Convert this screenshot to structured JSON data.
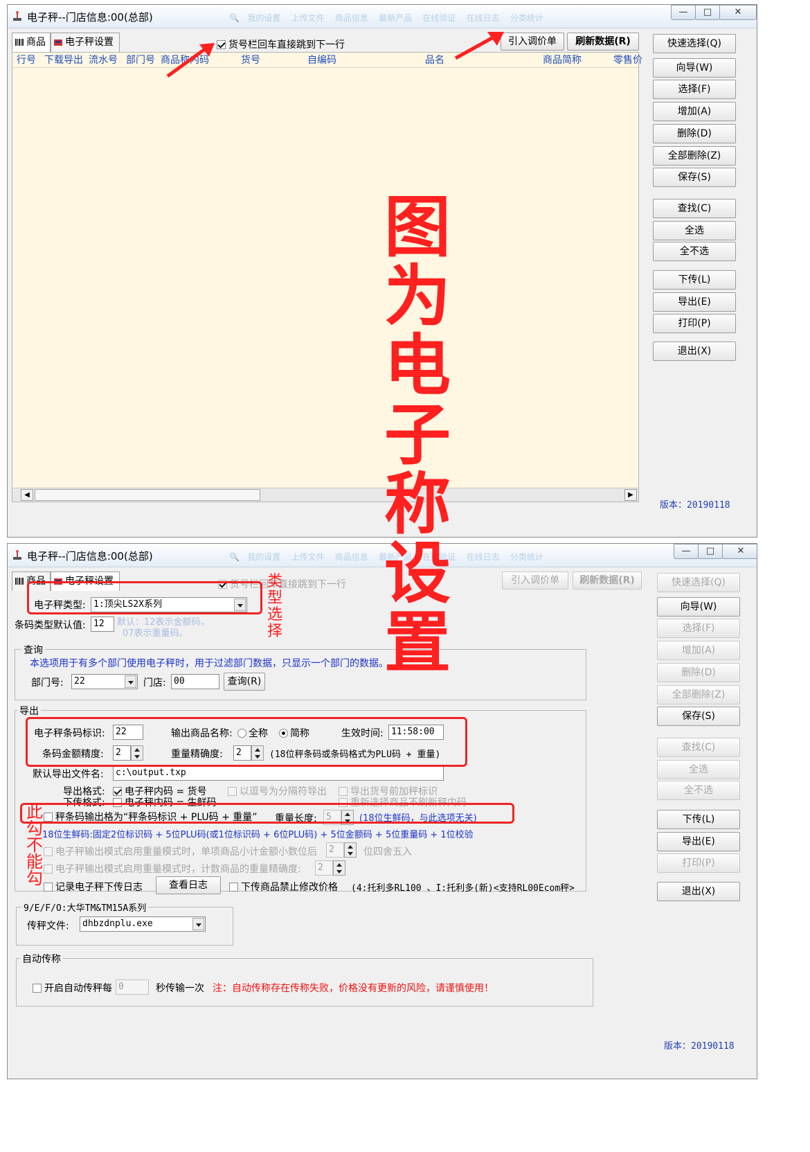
{
  "window1": {
    "title": "电子秤--门店信息:00(总部)",
    "window_controls": {
      "minimize": "—",
      "maximize": "□",
      "close": "✕"
    },
    "tabs": [
      {
        "label": "商品"
      },
      {
        "label": "电子秤设置"
      }
    ],
    "option_checkbox": {
      "label": "货号栏回车直接跳到下一行",
      "checked": true
    },
    "import_button": "引入调价单",
    "refresh_button": "刷新数据(R)",
    "columns": [
      "行号",
      "下载导出",
      "流水号",
      "部门号",
      "商品称内码",
      "货号",
      "自编码",
      "品名",
      "商品简称",
      "零售价"
    ],
    "side_buttons": [
      "快速选择(Q)",
      "向导(W)",
      "选择(F)",
      "增加(A)",
      "删除(D)",
      "全部删除(Z)",
      "保存(S)",
      "查找(C)",
      "全选",
      "全不选",
      "下传(L)",
      "导出(E)",
      "打印(P)",
      "退出(X)"
    ],
    "version": "版本：20190118"
  },
  "window2": {
    "title": "电子秤--门店信息:00(总部)",
    "window_controls": {
      "minimize": "—",
      "maximize": "□",
      "close": "✕"
    },
    "tabs": [
      {
        "label": "商品"
      },
      {
        "label": "电子秤设置"
      }
    ],
    "option_checkbox": {
      "label": "货号栏回车直接跳到下一行"
    },
    "import_button": "引入调价单",
    "refresh_button": "刷新数据(R)",
    "scale_type": {
      "label": "电子秤类型:",
      "value": "1:顶尖LS2X系列"
    },
    "barcode_default": {
      "label": "条码类型默认值:",
      "value": "12",
      "hint_line1": "默认：12表示金额码，",
      "hint_line2": "07表示重量码。"
    },
    "query_group": {
      "title": "查询",
      "desc": "本选项用于有多个部门使用电子秤时，用于过滤部门数据，只显示一个部门的数据。",
      "dept_label": "部门号:",
      "dept_value": "22",
      "store_label": "门店:",
      "store_value": "00",
      "query_button": "查询(R)"
    },
    "export_group": {
      "title": "导出",
      "barcode_flag_label": "电子秤条码标识:",
      "barcode_flag_value": "22",
      "name_output_label": "输出商品名称:",
      "name_full": "全称",
      "name_short": "简称",
      "effective_time_label": "生效时间:",
      "effective_time_value": "11:58:00",
      "amount_precision_label": "条码金额精度:",
      "amount_precision_value": "2",
      "weight_precision_label": "重量精确度:",
      "weight_precision_value": "2",
      "weight_precision_note": "(18位秤条码或条码格式为PLU码 + 重量)",
      "export_file_label": "默认导出文件名:",
      "export_file_value": "c:\\output.txp",
      "export_format_label": "导出格式:",
      "export_format_value": "电子秤内码 = 货号",
      "comma_sep": "以逗号为分隔符导出",
      "prefix_scale_flag": "导出货号前加秤标识",
      "download_format_label": "下传格式:",
      "download_format_value": "电子秤内码 = 生鲜码",
      "reselect_note": "重新选择商品不刷新秤内码",
      "plu_format": "秤条码输出格为“秤条码标识 + PLU码 + 重量”",
      "weight_length_label": "重量长度:",
      "weight_length_value": "5",
      "weight_length_note": "(18位生鲜码，与此选项无关)",
      "fresh_code_desc": "18位生鲜码:固定2位标识码 + 5位PLU码(或1位标识码 + 6位PLU码) + 5位金额码 + 5位重量码 + 1位校验",
      "subtotal_decimal": "电子秤输出模式启用重量模式时，单项商品小计金额小数位后",
      "subtotal_decimal_value": "2",
      "subtotal_round": "位四舍五入",
      "count_weight_precision": "电子秤输出模式启用重量模式时，计数商品的重量精确度:",
      "count_weight_precision_value": "2",
      "log_checkbox": "记录电子秤下传日志",
      "view_log_button": "查看日志",
      "forbid_price_edit": "下传商品禁止修改价格",
      "toledo_note": "(4:托利多RL100 、I:托利多(新)<支持RL00Ecom秤>"
    },
    "dahua_group": {
      "title": "9/E/F/O:大华TM&TM15A系列",
      "file_label": "传秤文件:",
      "file_value": "dhbzdnplu.exe"
    },
    "auto_group": {
      "title": "自动传称",
      "enable_label": "开启自动传秤每",
      "interval_value": "0",
      "interval_suffix": "秒传输一次",
      "warning": "注：自动传称存在传称失败，价格没有更新的风险，请谨慎使用！"
    },
    "side_buttons": [
      {
        "label": "快速选择(Q)",
        "enabled": false
      },
      {
        "label": "向导(W)",
        "enabled": true
      },
      {
        "label": "选择(F)",
        "enabled": false
      },
      {
        "label": "增加(A)",
        "enabled": false
      },
      {
        "label": "删除(D)",
        "enabled": false
      },
      {
        "label": "全部删除(Z)",
        "enabled": false
      },
      {
        "label": "保存(S)",
        "enabled": true
      },
      {
        "label": "查找(C)",
        "enabled": false
      },
      {
        "label": "全选",
        "enabled": false
      },
      {
        "label": "全不选",
        "enabled": false
      },
      {
        "label": "下传(L)",
        "enabled": true
      },
      {
        "label": "导出(E)",
        "enabled": true
      },
      {
        "label": "打印(P)",
        "enabled": false
      },
      {
        "label": "退出(X)",
        "enabled": true
      }
    ],
    "version": "版本：20190118"
  },
  "annotations": {
    "big_caption": "图为电子称设置",
    "type_select": "类型选择",
    "no_check": "此勾不能勾",
    "color": "#ff2020"
  }
}
